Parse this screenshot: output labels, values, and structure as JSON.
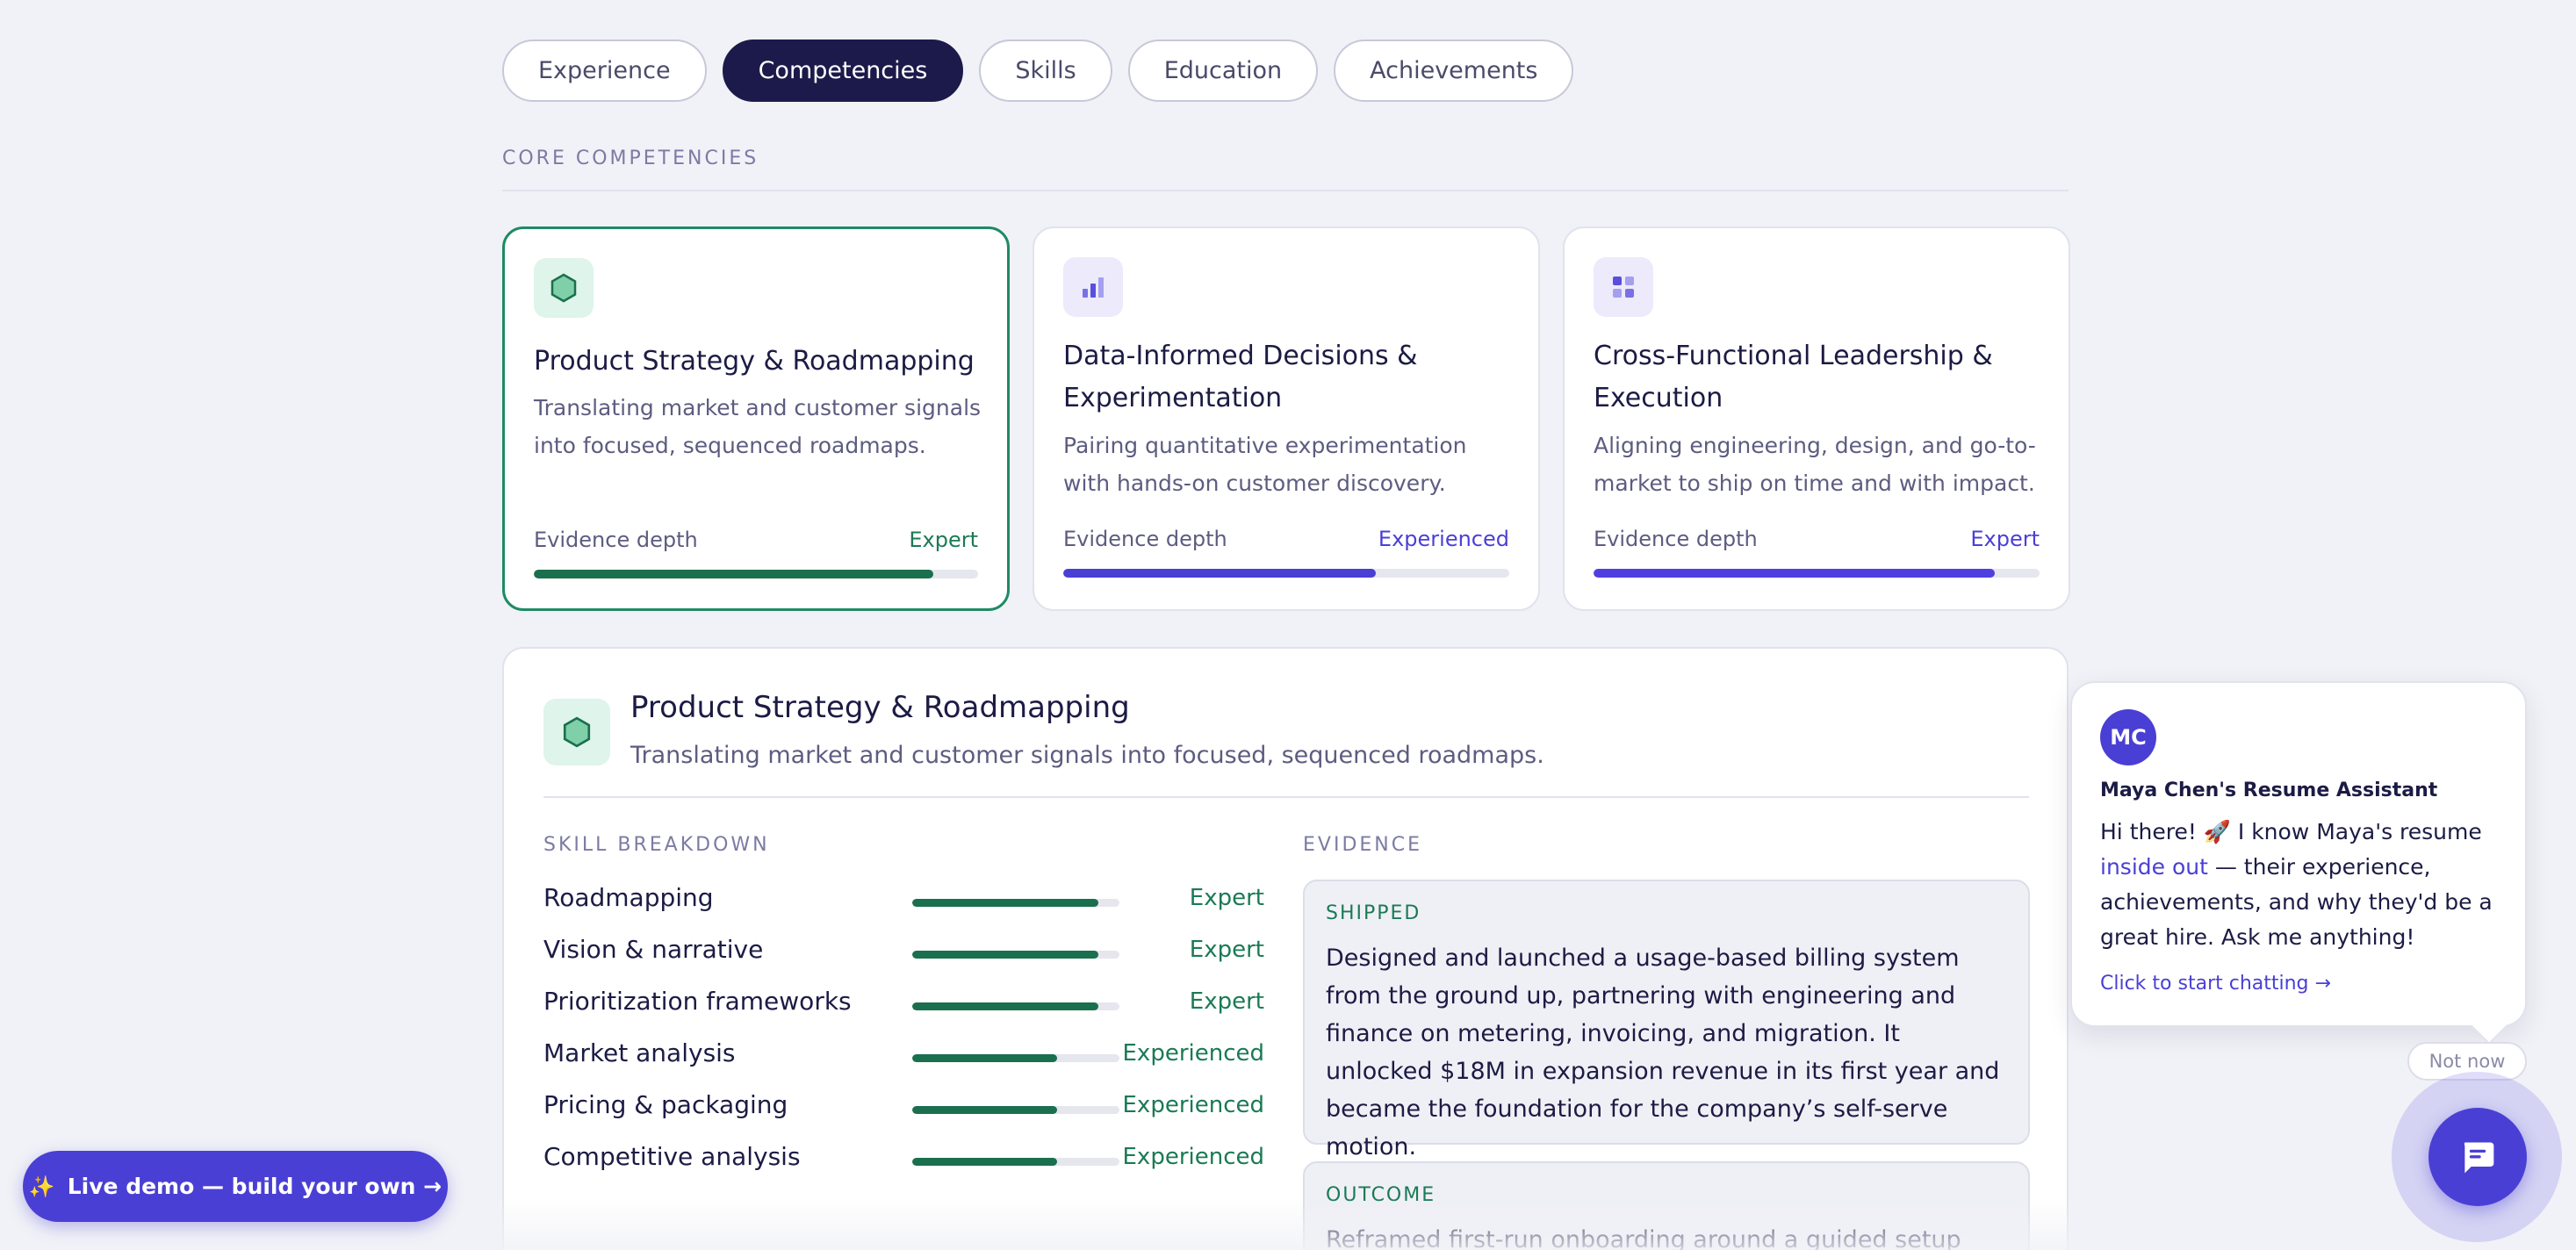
{
  "tabs": [
    {
      "label": "Experience",
      "active": false
    },
    {
      "label": "Competencies",
      "active": true
    },
    {
      "label": "Skills",
      "active": false
    },
    {
      "label": "Education",
      "active": false
    },
    {
      "label": "Achievements",
      "active": false
    }
  ],
  "core_label": "CORE COMPETENCIES",
  "cards": [
    {
      "icon": "hexagon-icon",
      "title": "Product Strategy & Roadmapping",
      "description": "Translating market and customer signals into focused, sequenced roadmaps.",
      "depth_label": "Evidence depth",
      "depth_value": "Expert",
      "depth_fraction": 0.9
    },
    {
      "icon": "bar-chart-icon",
      "title": "Data-Informed Decisions & Experimentation",
      "description": "Pairing quantitative experimentation with hands-on customer discovery.",
      "depth_label": "Evidence depth",
      "depth_value": "Experienced",
      "depth_fraction": 0.7
    },
    {
      "icon": "grid-icon",
      "title": "Cross-Functional Leadership & Execution",
      "description": "Aligning engineering, design, and go-to-market to ship on time and with impact.",
      "depth_label": "Evidence depth",
      "depth_value": "Expert",
      "depth_fraction": 0.9
    }
  ],
  "detail": {
    "title": "Product Strategy & Roadmapping",
    "subtitle": "Translating market and customer signals into focused, sequenced roadmaps.",
    "skill_label": "SKILL BREAKDOWN",
    "evidence_label": "EVIDENCE",
    "skills": [
      {
        "name": "Roadmapping",
        "level": "Expert",
        "fraction": 0.9
      },
      {
        "name": "Vision & narrative",
        "level": "Expert",
        "fraction": 0.9
      },
      {
        "name": "Prioritization frameworks",
        "level": "Expert",
        "fraction": 0.9
      },
      {
        "name": "Market analysis",
        "level": "Experienced",
        "fraction": 0.7
      },
      {
        "name": "Pricing & packaging",
        "level": "Experienced",
        "fraction": 0.7
      },
      {
        "name": "Competitive analysis",
        "level": "Experienced",
        "fraction": 0.7
      }
    ],
    "evidence": [
      {
        "tag": "SHIPPED",
        "text": "Designed and launched a usage-based billing system from the ground up, partnering with engineering and finance on metering, invoicing, and migration. It unlocked $18M in expansion revenue in its first year and became the foundation for the company’s self-serve motion."
      },
      {
        "tag": "OUTCOME",
        "text": "Reframed first-run onboarding around a guided setup flow"
      }
    ]
  },
  "live_demo": {
    "label": "Live demo — build your own →",
    "icon": "sparkle-icon"
  },
  "chat": {
    "avatar_initials": "MC",
    "assistant_name": "Maya Chen's Resume Assistant",
    "message_pre": "Hi there! 🚀 I know Maya's resume ",
    "message_highlight": "inside out",
    "message_post": " — their experience, achievements, and why they'd be a great hire. Ask me anything!",
    "cta": "Click to start chatting →",
    "dismiss": "Not now",
    "fab_icon": "chat-bubble-icon"
  },
  "colors": {
    "accent": "#4a3fd4",
    "green": "#1a6f4f",
    "navy": "#1c1a4a",
    "background": "#f1f2f7"
  }
}
